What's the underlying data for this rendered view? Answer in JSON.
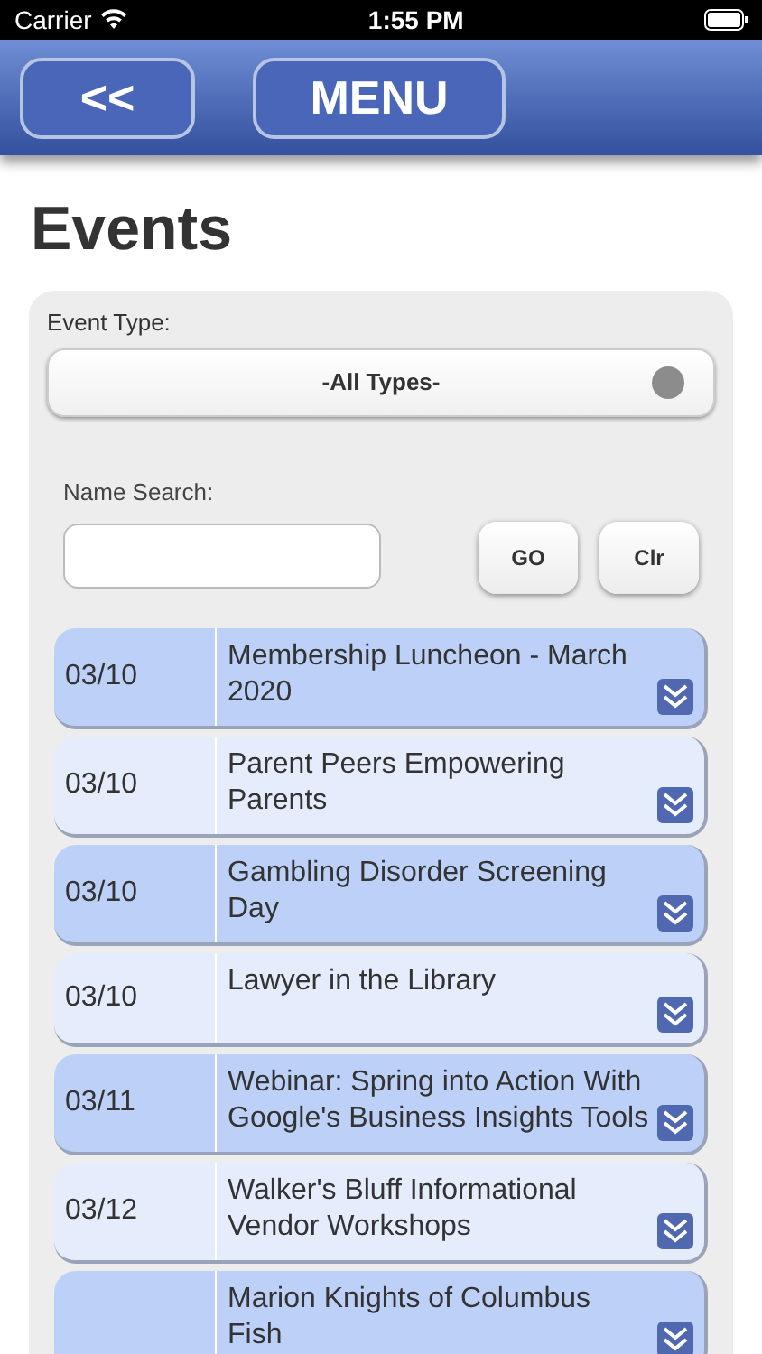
{
  "status_bar": {
    "carrier": "Carrier",
    "time": "1:55 PM"
  },
  "nav": {
    "back_button": "<<",
    "menu_button": "MENU"
  },
  "title": "Events",
  "filter": {
    "event_type_label": "Event Type:",
    "event_type_value": "-All Types-",
    "name_search_label": "Name Search:",
    "go_button": "GO",
    "clear_button": "Clr"
  },
  "events": [
    {
      "date": "03/10",
      "name": "Membership Luncheon - March 2020"
    },
    {
      "date": "03/10",
      "name": "Parent Peers Empowering Parents"
    },
    {
      "date": "03/10",
      "name": "Gambling Disorder Screening Day"
    },
    {
      "date": "03/10",
      "name": "Lawyer in the Library"
    },
    {
      "date": "03/11",
      "name": "Webinar: Spring into Action With Google's Business Insights Tools"
    },
    {
      "date": "03/12",
      "name": "Walker's Bluff Informational Vendor Workshops"
    },
    {
      "name": "Marion Knights of Columbus Fish"
    }
  ]
}
